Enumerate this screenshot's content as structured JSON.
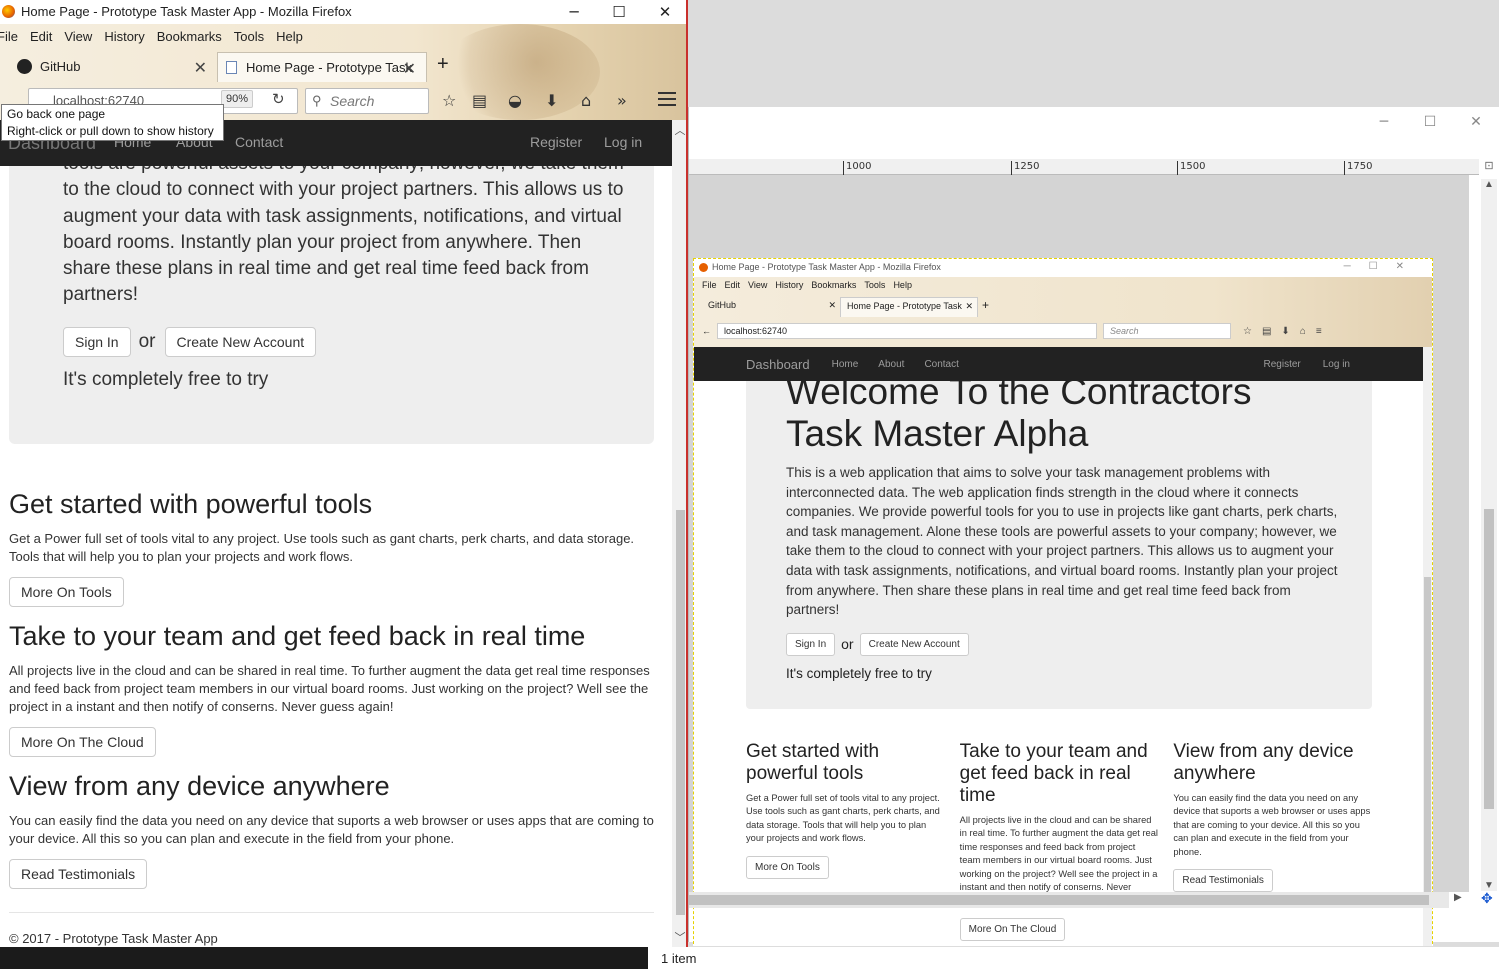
{
  "window": {
    "title": "Home Page - Prototype Task Master App - Mozilla Firefox",
    "min": "─",
    "max": "☐",
    "close": "✕"
  },
  "menu": [
    "File",
    "Edit",
    "View",
    "History",
    "Bookmarks",
    "Tools",
    "Help"
  ],
  "tabs": [
    {
      "label": "GitHub",
      "close": "✕"
    },
    {
      "label": "Home Page - Prototype Task",
      "close": "✕"
    }
  ],
  "newtab": "+",
  "url": "localhost:62740",
  "zoom": "90%",
  "search_placeholder": "Search",
  "tooltip": {
    "line1": "Go back one page",
    "line2": "Right-click or pull down to show history"
  },
  "site_nav": {
    "brand": "Dashboard",
    "links": [
      "Home",
      "About",
      "Contact"
    ],
    "right": [
      "Register",
      "Log in"
    ]
  },
  "jumbotron": {
    "title": "Welcome To the Contractors Task Master Alpha",
    "lead_visible": "tools are powerful assets to your company; however, we take them to the cloud to connect with your project partners. This allows us to augment your data with task assignments, notifications, and virtual board rooms. Instantly plan your project from anywhere. Then share these plans in real time and get real time feed back from partners!",
    "lead_full": "This is a web application that aims to solve your task management problems with interconnected data. The web application finds strength in the cloud where it connects companies. We provide powerful tools for you to use in projects like gant charts, perk charts, and task management. Alone these tools are powerful assets to your company; however, we take them to the cloud to connect with your project partners. This allows us to augment your data with task assignments, notifications, and virtual board rooms. Instantly plan your project from anywhere. Then share these plans in real time and get real time feed back from partners!",
    "sign_in": "Sign In",
    "or": "or",
    "create": "Create New Account",
    "free": "It's completely free to try"
  },
  "sections": [
    {
      "title": "Get started with powerful tools",
      "text": "Get a Power full set of tools vital to any project. Use tools such as gant charts, perk charts, and data storage. Tools that will help you to plan your projects and work flows.",
      "button": "More On Tools"
    },
    {
      "title": "Take to your team and get feed back in real time",
      "text": "All projects live in the cloud and can be shared in real time. To further augment the data get real time responses and feed back from project team members in our virtual board rooms. Just working on the project? Well see the project in a instant and then notify of conserns. Never guess again!",
      "button": "More On The Cloud"
    },
    {
      "title": "View from any device anywhere",
      "text": "You can easily find the data you need on any device that suports a web browser or uses apps that are coming to your device. All this so you can plan and execute in the field from your phone.",
      "button": "Read Testimonials"
    }
  ],
  "footer": "© 2017 - Prototype Task Master App",
  "editor": {
    "ruler_marks": [
      "1000",
      "1250",
      "1500",
      "1750"
    ],
    "status": "1 item",
    "embed_title": "Home Page - Prototype Task Master App - Mozilla Firefox"
  }
}
